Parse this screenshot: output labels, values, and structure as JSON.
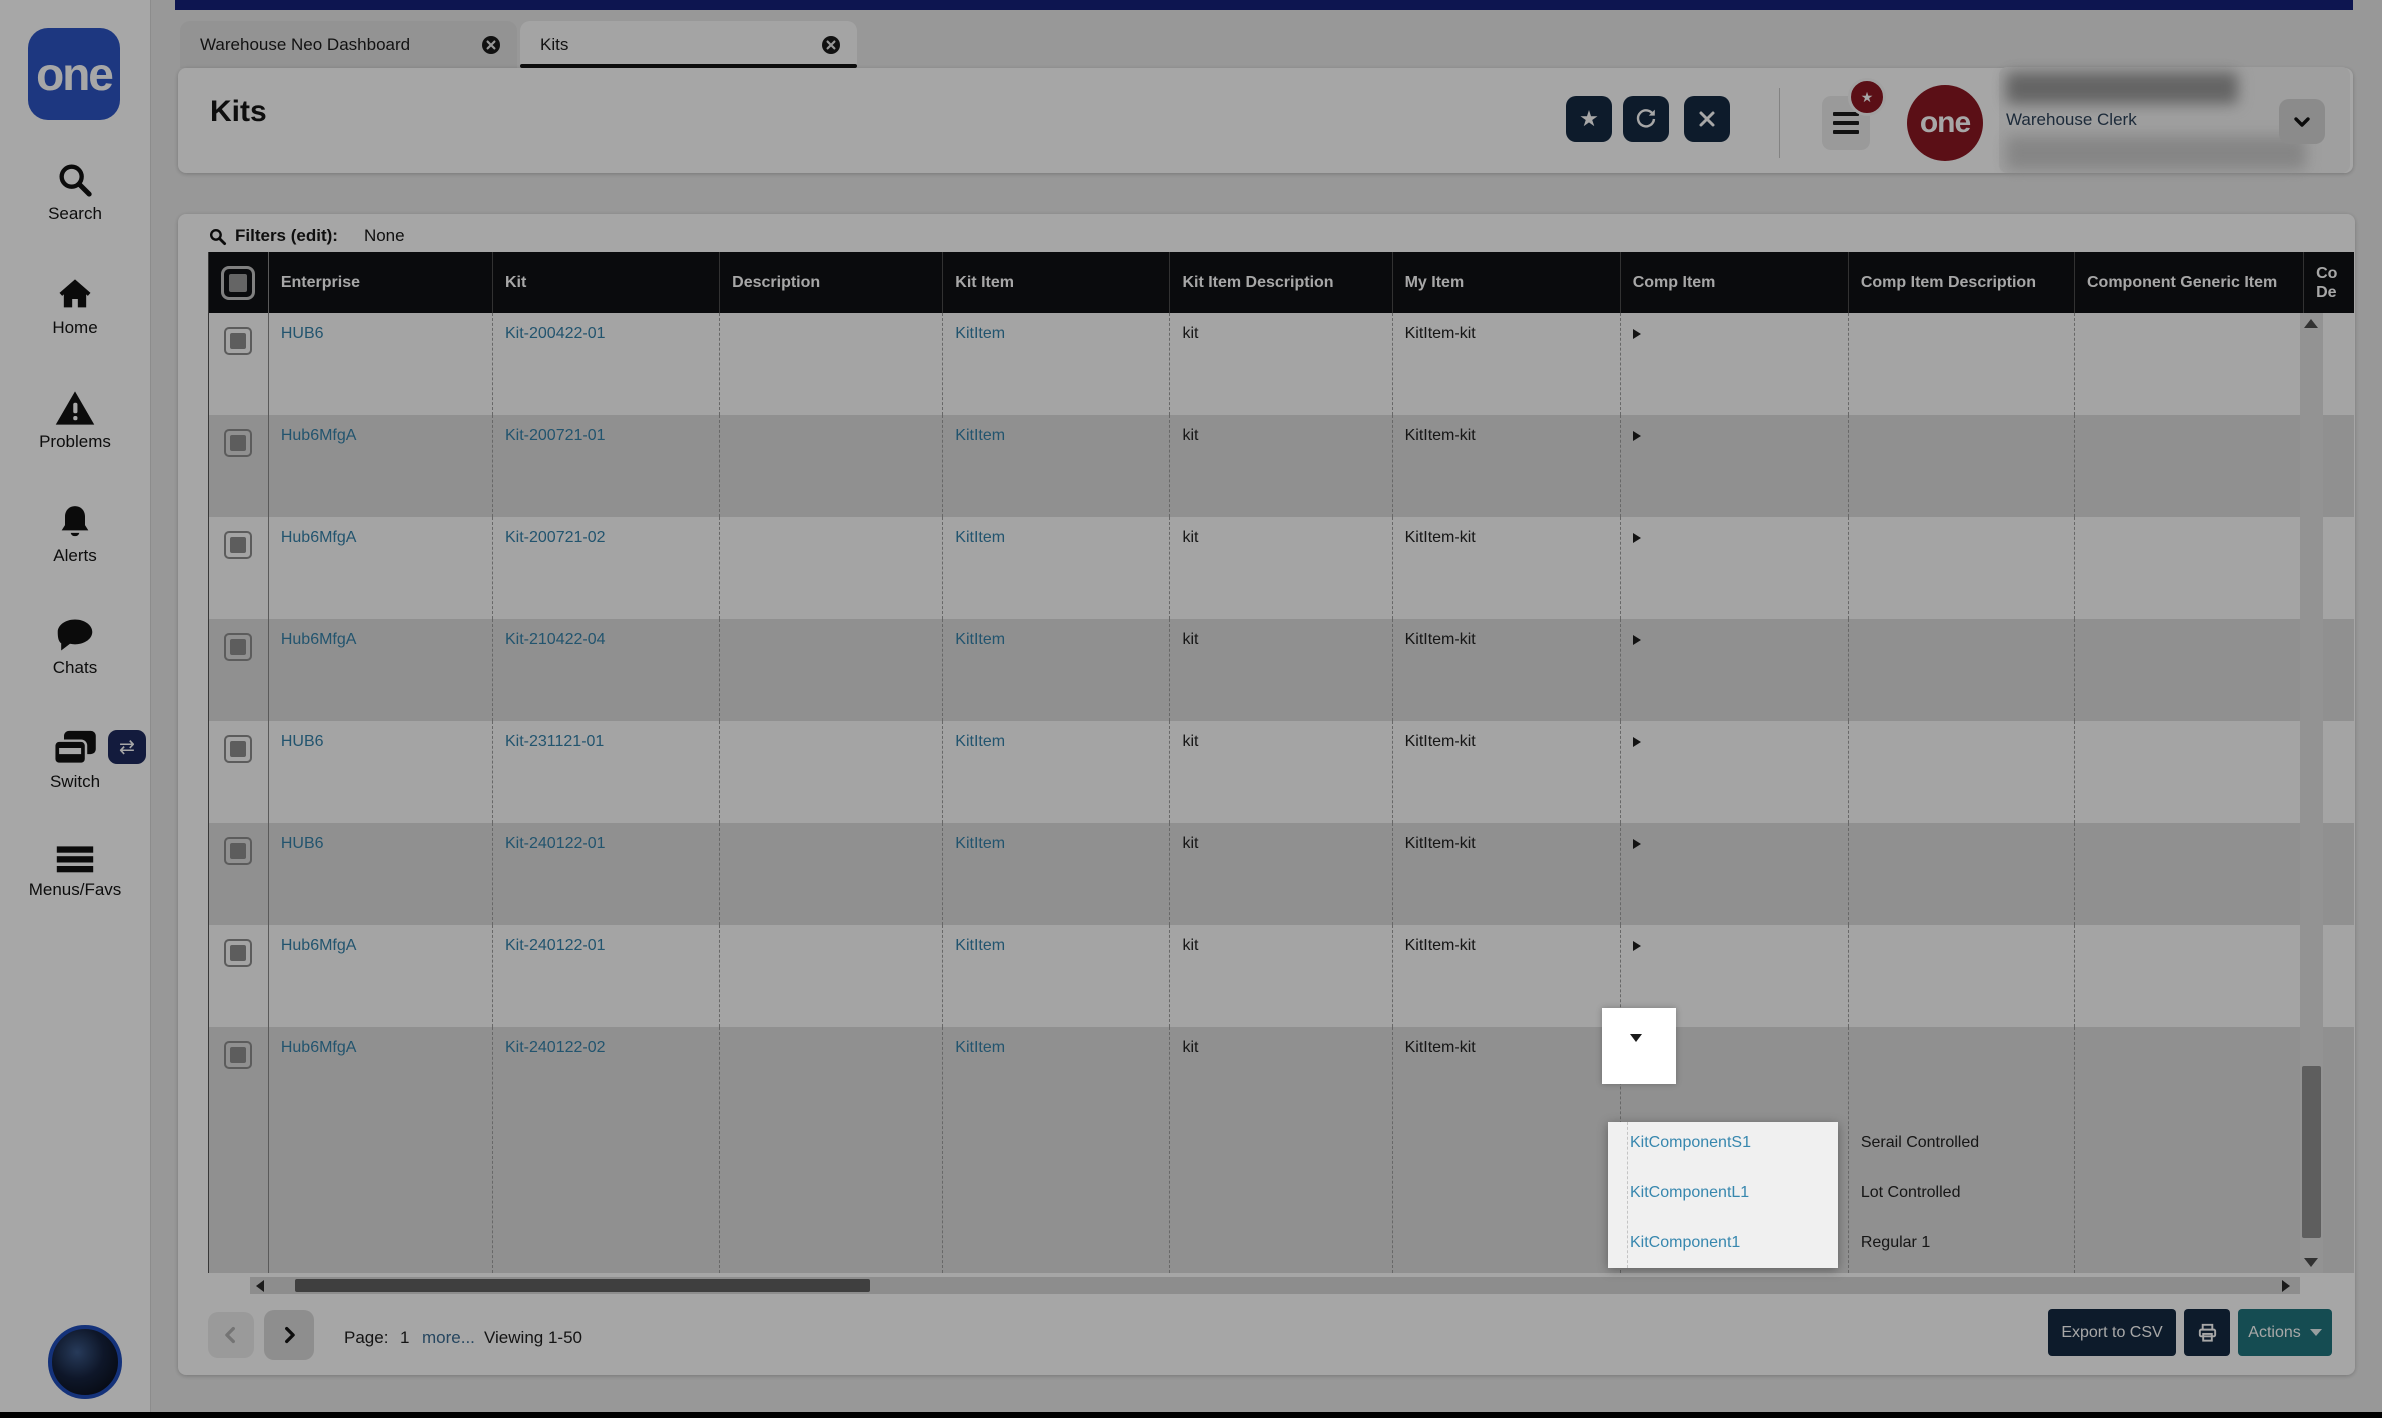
{
  "sidebar": {
    "logo_text": "one",
    "items": [
      {
        "label": "Search",
        "icon": "search-icon"
      },
      {
        "label": "Home",
        "icon": "home-icon"
      },
      {
        "label": "Problems",
        "icon": "warning-triangle-icon"
      },
      {
        "label": "Alerts",
        "icon": "bell-icon"
      },
      {
        "label": "Chats",
        "icon": "chat-bubble-icon"
      },
      {
        "label": "Switch",
        "icon": "switch-windows-icon"
      },
      {
        "label": "Menus/Favs",
        "icon": "hamburger-icon"
      }
    ],
    "switch_badge_glyph": "⇄"
  },
  "tabs": [
    {
      "label": "Warehouse Neo Dashboard",
      "active": false
    },
    {
      "label": "Kits",
      "active": true
    }
  ],
  "header": {
    "title": "Kits",
    "star_glyph": "★",
    "badge_star_glyph": "★",
    "avatar_text": "one",
    "user_role": "Warehouse Clerk"
  },
  "filters": {
    "label": "Filters (edit):",
    "value": "None"
  },
  "table": {
    "columns": [
      "Enterprise",
      "Kit",
      "Description",
      "Kit Item",
      "Kit Item Description",
      "My Item",
      "Comp Item",
      "Comp Item Description",
      "Component Generic Item"
    ],
    "clipped_column": {
      "line1": "Co",
      "line2": "De"
    },
    "rows": [
      {
        "enterprise": "HUB6",
        "kit": "Kit-200422-01",
        "kit_item": "KitItem",
        "kit_item_description": "kit",
        "my_item": "KitItem-kit"
      },
      {
        "enterprise": "Hub6MfgA",
        "kit": "Kit-200721-01",
        "kit_item": "KitItem",
        "kit_item_description": "kit",
        "my_item": "KitItem-kit"
      },
      {
        "enterprise": "Hub6MfgA",
        "kit": "Kit-200721-02",
        "kit_item": "KitItem",
        "kit_item_description": "kit",
        "my_item": "KitItem-kit"
      },
      {
        "enterprise": "Hub6MfgA",
        "kit": "Kit-210422-04",
        "kit_item": "KitItem",
        "kit_item_description": "kit",
        "my_item": "KitItem-kit"
      },
      {
        "enterprise": "HUB6",
        "kit": "Kit-231121-01",
        "kit_item": "KitItem",
        "kit_item_description": "kit",
        "my_item": "KitItem-kit"
      },
      {
        "enterprise": "HUB6",
        "kit": "Kit-240122-01",
        "kit_item": "KitItem",
        "kit_item_description": "kit",
        "my_item": "KitItem-kit"
      },
      {
        "enterprise": "Hub6MfgA",
        "kit": "Kit-240122-01",
        "kit_item": "KitItem",
        "kit_item_description": "kit",
        "my_item": "KitItem-kit"
      },
      {
        "enterprise": "Hub6MfgA",
        "kit": "Kit-240122-02",
        "kit_item": "KitItem",
        "kit_item_description": "kit",
        "my_item": "KitItem-kit"
      }
    ],
    "expanded_components": [
      {
        "name": "KitComponentS1",
        "description": "Serail Controlled"
      },
      {
        "name": "KitComponentL1",
        "description": "Lot Controlled"
      },
      {
        "name": "KitComponent1",
        "description": "Regular 1"
      }
    ]
  },
  "pagination": {
    "page_label": "Page:",
    "page_number": "1",
    "more_label": "more...",
    "viewing_label": "Viewing 1-50"
  },
  "footer": {
    "export_label": "Export to CSV",
    "actions_label": "Actions"
  },
  "colors": {
    "topbar_blue": "#15217a",
    "logo_blue": "#2d55c4",
    "maroon": "#8c1722",
    "table_header_bg": "#101114",
    "link_blue": "#3580a8",
    "dropdown_link_blue": "#3787ae",
    "navy_button": "#142a43",
    "teal_button": "#20757e",
    "row_stripe": "#dcdcdc"
  }
}
